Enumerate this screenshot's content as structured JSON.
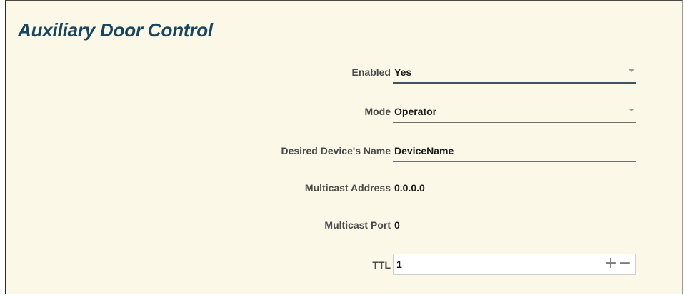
{
  "panel": {
    "title": "Auxiliary Door Control"
  },
  "fields": {
    "enabled": {
      "label": "Enabled",
      "value": "Yes"
    },
    "mode": {
      "label": "Mode",
      "value": "Operator"
    },
    "device_name": {
      "label": "Desired Device's Name",
      "value": "DeviceName"
    },
    "multicast_address": {
      "label": "Multicast Address",
      "value": "0.0.0.0"
    },
    "multicast_port": {
      "label": "Multicast Port",
      "value": "0"
    },
    "ttl": {
      "label": "TTL",
      "value": "1",
      "increment": "+",
      "decrement": "−"
    }
  },
  "icons": {
    "dropdown": "chevron-down-icon",
    "increment": "plus-icon",
    "decrement": "minus-icon"
  },
  "colors": {
    "panel_background": "#fbf8e7",
    "title": "#18455f",
    "label": "#4a4a4a",
    "active_underline": "#3e5366"
  }
}
